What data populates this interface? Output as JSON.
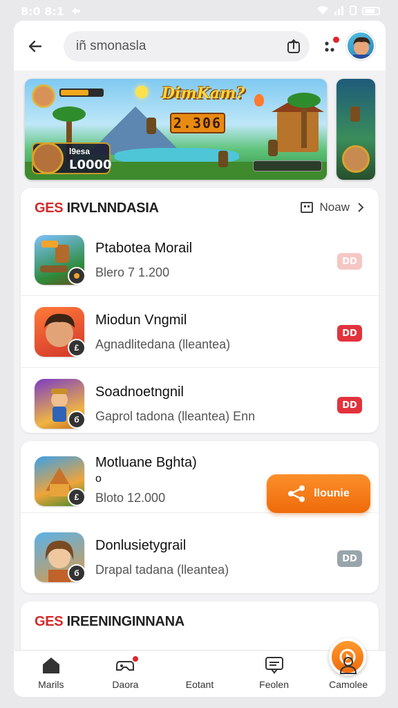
{
  "status_bar": {
    "time": "8:0 8:1",
    "signal": "wifi-signal-battery"
  },
  "search": {
    "value": "iñ smonasla"
  },
  "banner": {
    "title": "DimKam?",
    "score": "2.306",
    "player_name": "l9esa",
    "coins": "L0000"
  },
  "section1": {
    "heading_accent": "GES",
    "heading_rest": "IRVLNNDASIA",
    "view_all": "Noaw",
    "items": [
      {
        "title": "Ptabotea Morail",
        "subtitle": "Blero 7 1.200",
        "tag": "DD"
      },
      {
        "title": "Miodun Vngmil",
        "subtitle": "Agnadlitedana (lleantea)",
        "tag": "DD",
        "badge": "£"
      },
      {
        "title": "Soadnoetngnil",
        "subtitle": "Gaprol tadona (lleantea) Enn",
        "tag": "DD",
        "badge": "б"
      }
    ]
  },
  "section2": {
    "items": [
      {
        "title": "Motluane Bghta)",
        "extra": "o",
        "subtitle": "Bloto 12.000",
        "button": "llounie",
        "badge": "£"
      },
      {
        "title": "Donlusietygrail",
        "subtitle": "Drapal tadana (lleantea)",
        "tag": "DD",
        "badge": "б"
      }
    ]
  },
  "section3": {
    "heading_accent": "GES",
    "heading_rest": "IREENINGINNANA"
  },
  "bottom_nav": [
    {
      "label": "Marils",
      "icon": "home-icon"
    },
    {
      "label": "Daora",
      "icon": "gamepad-icon"
    },
    {
      "label": "Eotant",
      "icon": "play-icon"
    },
    {
      "label": "Feolen",
      "icon": "chat-icon"
    },
    {
      "label": "Camolee",
      "icon": "user-icon"
    }
  ],
  "colors": {
    "accent_red": "#d42a2a",
    "orange": "#f07a14",
    "tag_red": "#e2333c"
  }
}
